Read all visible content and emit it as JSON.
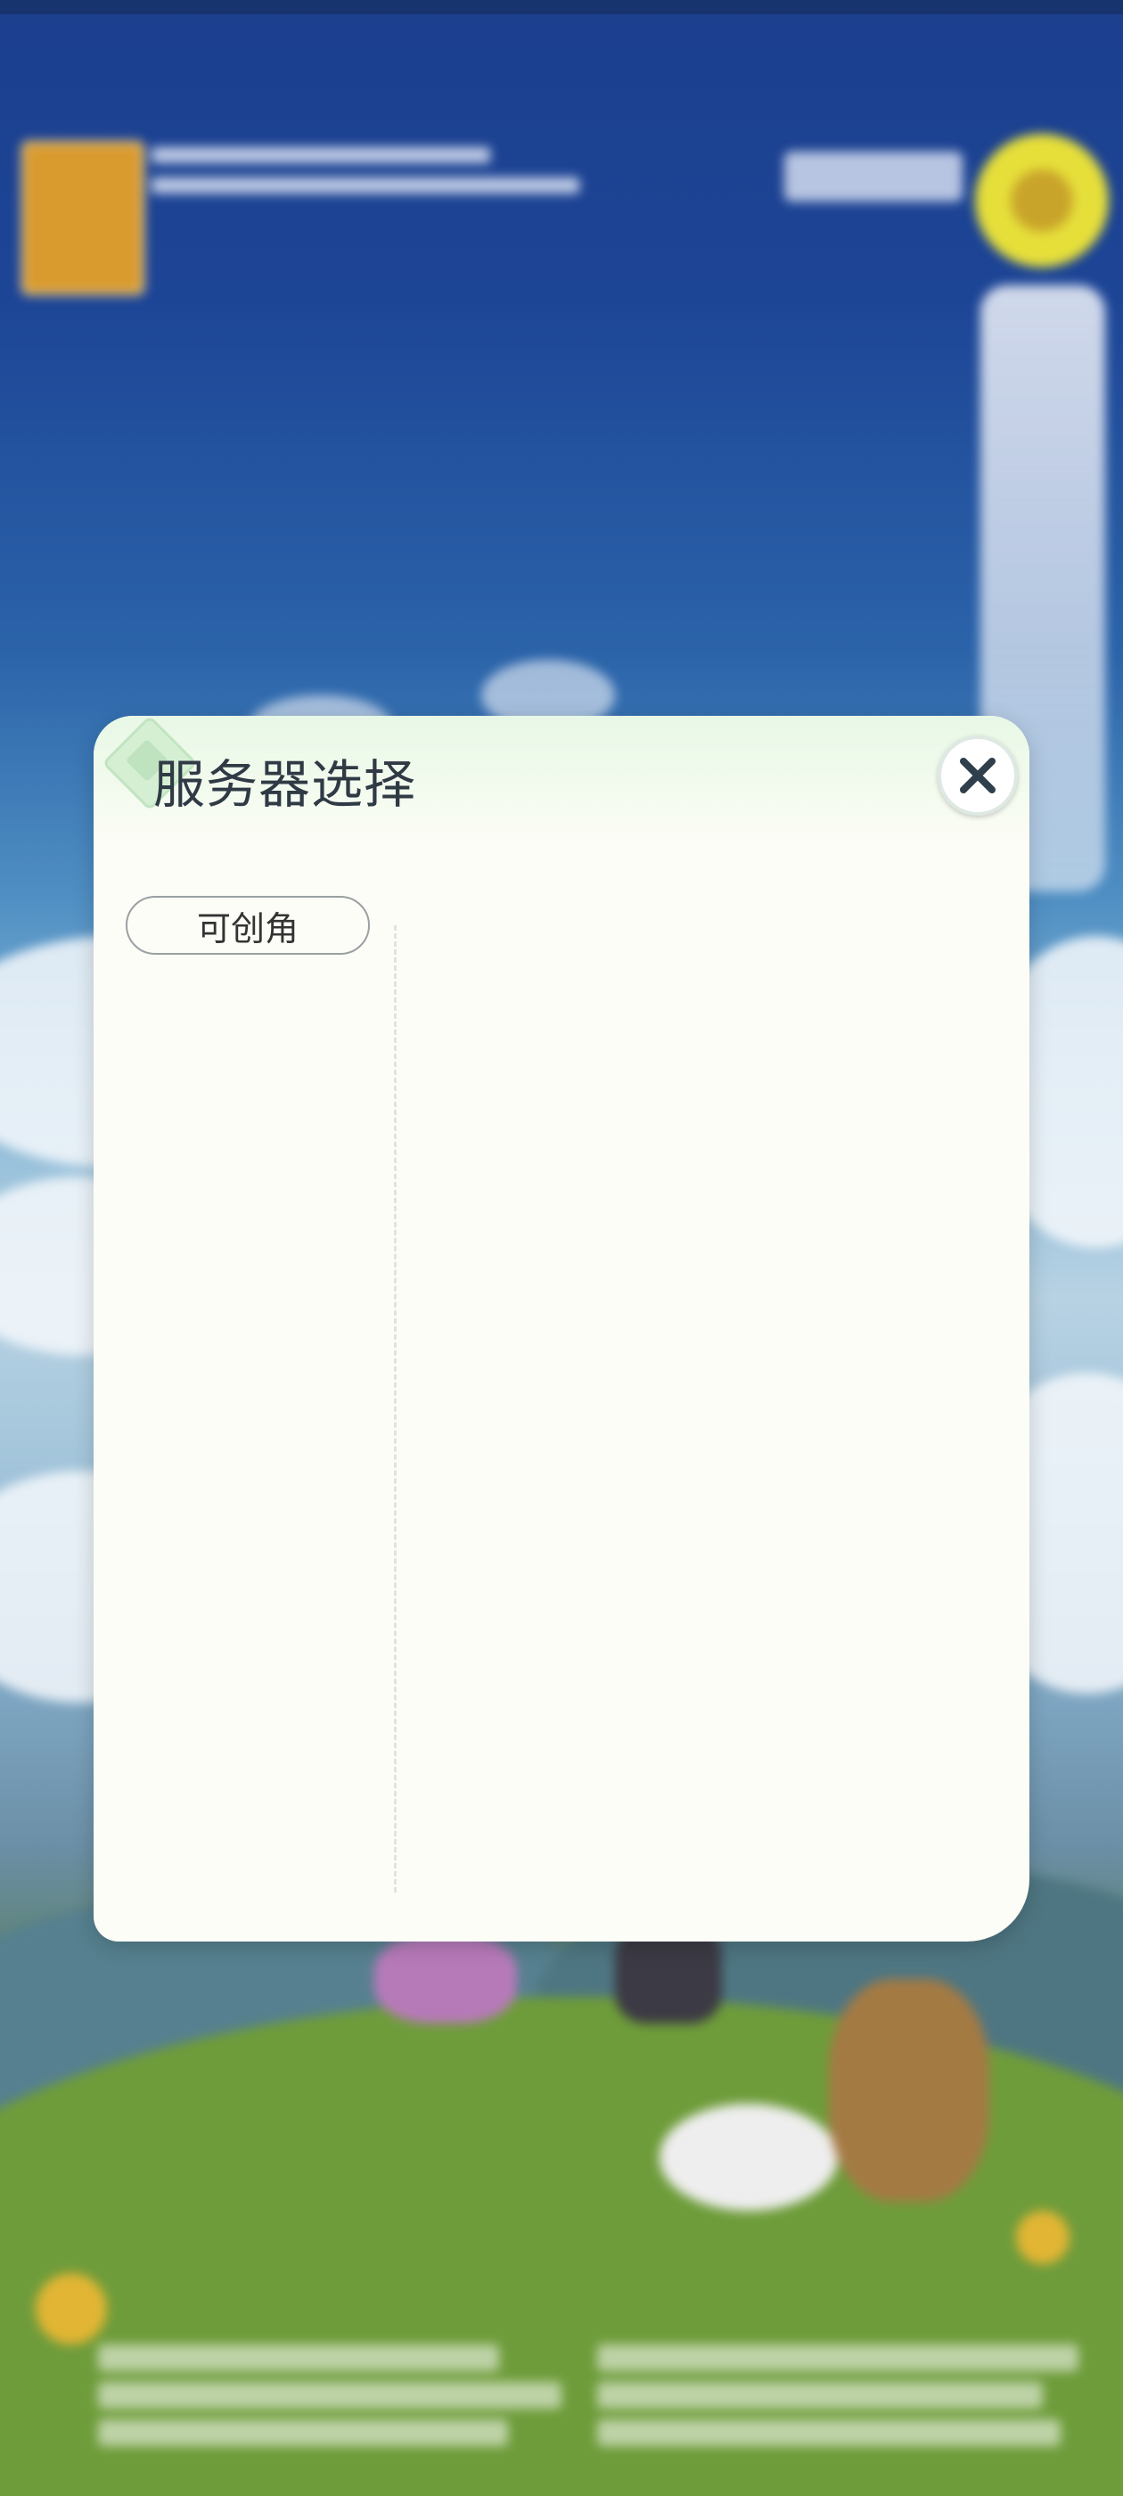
{
  "dialog": {
    "title": "服务器选择",
    "close_label": "close",
    "tabs": [
      {
        "label": "可创角",
        "selected": true
      }
    ],
    "server_list": []
  },
  "colors": {
    "dialog_bg": "#fdfdf7",
    "header_tint": "#e8f8e6",
    "title_text": "#2f3a45",
    "close_icon": "#2f3f4b",
    "tab_border": "#9aa0a3"
  },
  "icons": {
    "close": "close-icon",
    "title_ornament": "diamond-ornament-icon"
  }
}
